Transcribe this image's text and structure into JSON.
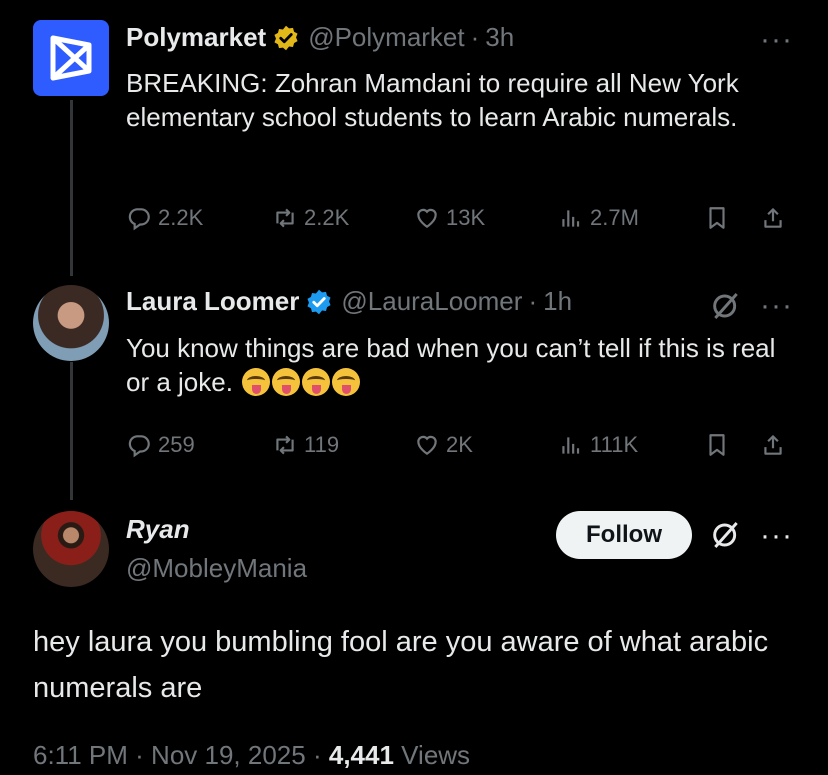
{
  "tweets": [
    {
      "name": "Polymarket",
      "verified": "gold",
      "handle": "@Polymarket",
      "sep": "·",
      "time": "3h",
      "text": "BREAKING: Zohran Mamdani to require all New York elementary school students to learn Arabic numerals.",
      "replies": "2.2K",
      "reposts": "2.2K",
      "likes": "13K",
      "views": "2.7M",
      "more": "···"
    },
    {
      "name": "Laura Loomer",
      "verified": "blue",
      "handle": "@LauraLoomer",
      "sep": "·",
      "time": "1h",
      "text": "You know things are bad when you can’t tell if this is real or a joke.",
      "emoji_count": 4,
      "replies": "259",
      "reposts": "119",
      "likes": "2K",
      "views": "111K",
      "more": "···"
    }
  ],
  "main": {
    "name": "Ryan",
    "handle": "@MobleyMania",
    "follow_label": "Follow",
    "more": "···",
    "text": "hey laura you bumbling fool are you aware of what arabic numerals are",
    "time": "6:11 PM",
    "sep": "·",
    "date": "Nov 19, 2025",
    "views_count": "4,441",
    "views_label": "Views"
  },
  "colors": {
    "background": "#000000",
    "text": "#e7e9ea",
    "muted": "#71767b",
    "gold_badge": "#e2b719",
    "blue_badge": "#1d9bf0",
    "polymarket_brand": "#2e5cff"
  },
  "icons": [
    "reply-icon",
    "repost-icon",
    "like-icon",
    "views-icon",
    "bookmark-icon",
    "share-icon",
    "grok-icon",
    "more-icon",
    "verified-badge-icon"
  ]
}
